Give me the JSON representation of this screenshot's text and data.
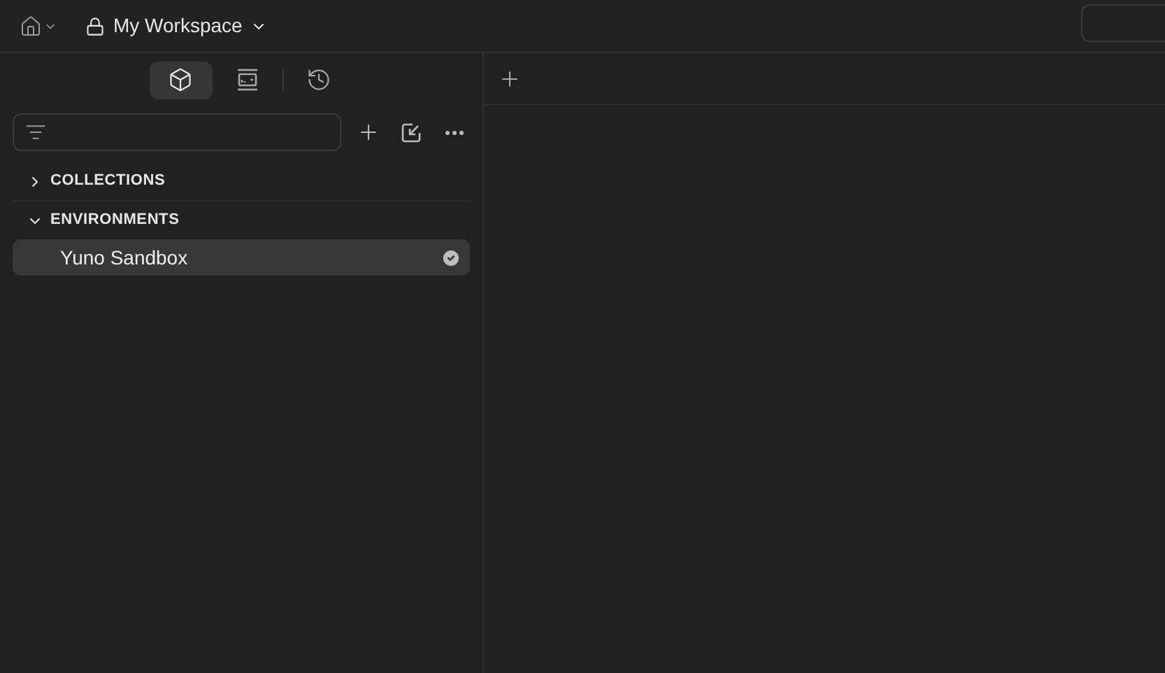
{
  "header": {
    "workspace": "My Workspace"
  },
  "sidebar": {
    "tabs": [
      {
        "kind": "collections",
        "selected": true
      },
      {
        "kind": "mock",
        "selected": false
      },
      {
        "kind": "history",
        "selected": false
      }
    ],
    "sections": [
      {
        "label": "COLLECTIONS",
        "expanded": false
      },
      {
        "label": "ENVIRONMENTS",
        "expanded": true,
        "items": [
          {
            "name": "Yuno Sandbox",
            "selected": true,
            "active": true
          }
        ]
      }
    ]
  }
}
